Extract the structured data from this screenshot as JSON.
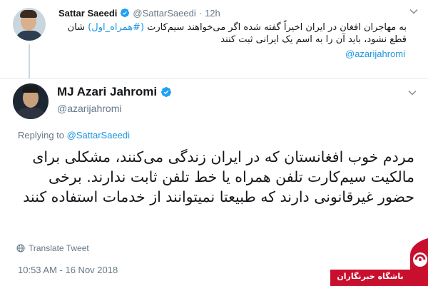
{
  "parent_tweet": {
    "name": "Sattar Saeedi",
    "handle": "@SattarSaeedi",
    "separator": "·",
    "time": "12h",
    "text_before_hashtag": "به مهاجران افغان در ایران اخیراً گفته شده اگر می‌خواهند سیم‌کارت ",
    "hashtag": "(#همراه_اول)",
    "text_after_hashtag": " شان قطع نشود، باید آن را به اسم یک ایرانی ثبت کنند",
    "mention": "@azarijahromi"
  },
  "main_tweet": {
    "name": "MJ Azari Jahromi",
    "handle": "@azarijahromi",
    "replying_prefix": "Replying to ",
    "replying_to": "@SattarSaeedi",
    "text": "مردم خوب افغانستان که در ایران زندگی می‌کنند، مشکلی برای مالکیت سیم‌کارت تلفن همراه یا خط تلفن ثابت ندارند. برخی حضور غیرقانونی دارند که طبیعتا نمیتوانند از خدمات استفاده کنند",
    "translate_label": "Translate Tweet",
    "timestamp": "10:53 AM - 16 Nov 2018"
  },
  "watermark": {
    "text": "باشگاه خبرنگاران"
  },
  "icons": {
    "verified": "verified-badge-icon",
    "chevron": "chevron-down-icon",
    "globe": "globe-icon"
  },
  "colors": {
    "link": "#1b95e0",
    "verified": "#1da1f2",
    "muted": "#657786",
    "watermark_red": "#c8102e"
  }
}
